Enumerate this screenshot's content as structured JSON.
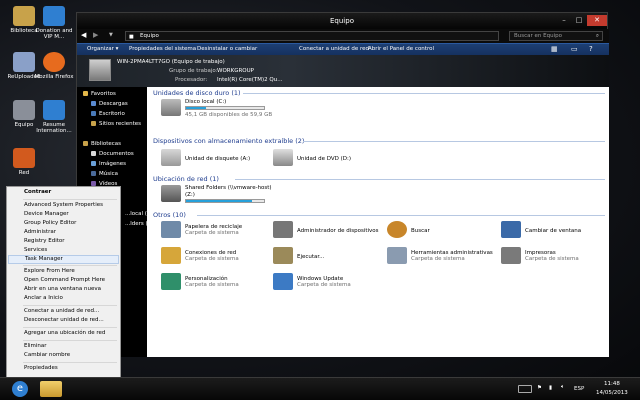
{
  "desktop": {
    "icons": [
      {
        "label": "Biblioteca",
        "color": "#c8a24a"
      },
      {
        "label": "Donation and VIP M...",
        "color": "#2f7fd1"
      },
      {
        "label": "ReUploaded",
        "color": "#8aa0c8"
      },
      {
        "label": "Mozilla Firefox",
        "color": "#e76b1e"
      },
      {
        "label": "Equipo",
        "color": "#8a8f99"
      },
      {
        "label": "Resume Internation...",
        "color": "#2f7fd1"
      },
      {
        "label": "Red",
        "color": "#d25a1e"
      }
    ]
  },
  "window": {
    "title": "Equipo",
    "address": "Equipo",
    "search_placeholder": "Buscar en Equipo",
    "toolbar": [
      "Organizar ▾",
      "Propiedades del sistema",
      "Desinstalar o cambiar",
      "Conectar a unidad de red",
      "Abrir el Panel de control"
    ],
    "details": {
      "computer_name": "WIN-2PMA4LTT7GO (Equipo de trabajo)",
      "workgroup_label": "Grupo de trabajo:",
      "workgroup": "WORKGROUP",
      "processor_label": "Procesador:",
      "processor": "Intel(R) Core(TM)2 Qu..."
    },
    "nav": {
      "favorites": "Favoritos",
      "descargas": "Descargas",
      "escritorio": "Escritorio",
      "sitios": "Sitios recientes",
      "bibliotecas": "Bibliotecas",
      "documentos": "Documentos",
      "imagenes": "Imágenes",
      "musica": "Música",
      "videos": "Vídeos",
      "local": "...local (C:)",
      "folders": "...lders (\\\\"
    },
    "sections": {
      "hdd": "Unidades de disco duro (1)",
      "removable": "Dispositivos con almacenamiento extraíble (2)",
      "network": "Ubicación de red (1)",
      "other": "Otros (10)"
    },
    "drives": {
      "c_label": "Disco local (C:)",
      "c_free": "45,1 GB disponibles de 59,9 GB",
      "c_usage": 0.25,
      "floppy": "Unidad de disquete (A:)",
      "dvd": "Unidad de DVD (D:)",
      "shared": "Shared Folders (\\\\vmware-host)",
      "shared_letter": "(Z:)",
      "z_usage": 0.85
    },
    "other_items": [
      {
        "name": "Papelera de reciclaje",
        "sub": "Carpeta de sistema",
        "color": "#6f8aa8"
      },
      {
        "name": "Administrador de dispositivos",
        "sub": "",
        "color": "#777777"
      },
      {
        "name": "Buscar",
        "sub": "",
        "color": "#c8862a"
      },
      {
        "name": "Cambiar de ventana",
        "sub": "",
        "color": "#3b6aa8"
      },
      {
        "name": "Conexiones de red",
        "sub": "Carpeta de sistema",
        "color": "#d6a63a"
      },
      {
        "name": "Ejecutar...",
        "sub": "",
        "color": "#9b8a5a"
      },
      {
        "name": "Herramientas administrativas",
        "sub": "Carpeta de sistema",
        "color": "#8a9bb0"
      },
      {
        "name": "Impresoras",
        "sub": "Carpeta de sistema",
        "color": "#7a7a7a"
      },
      {
        "name": "Personalización",
        "sub": "Carpeta de sistema",
        "color": "#2f8f6a"
      },
      {
        "name": "Windows Update",
        "sub": "Carpeta de sistema",
        "color": "#3c7ac4"
      }
    ]
  },
  "context_menu": {
    "items": [
      "Contraer",
      "Advanced System Properties",
      "Device Manager",
      "Group Policy Editor",
      "Administrar",
      "Registry Editor",
      "Services",
      "Task Manager",
      "Explore From Here",
      "Open Command Prompt Here",
      "Abrir en una ventana nueva",
      "Anclar a Inicio",
      "Conectar a unidad de red...",
      "Desconectar unidad de red...",
      "Agregar una ubicación de red",
      "Eliminar",
      "Cambiar nombre",
      "Propiedades"
    ],
    "selected": "Task Manager"
  },
  "taskbar": {
    "lang": "ESP",
    "time": "11:48",
    "date": "14/05/2013"
  }
}
